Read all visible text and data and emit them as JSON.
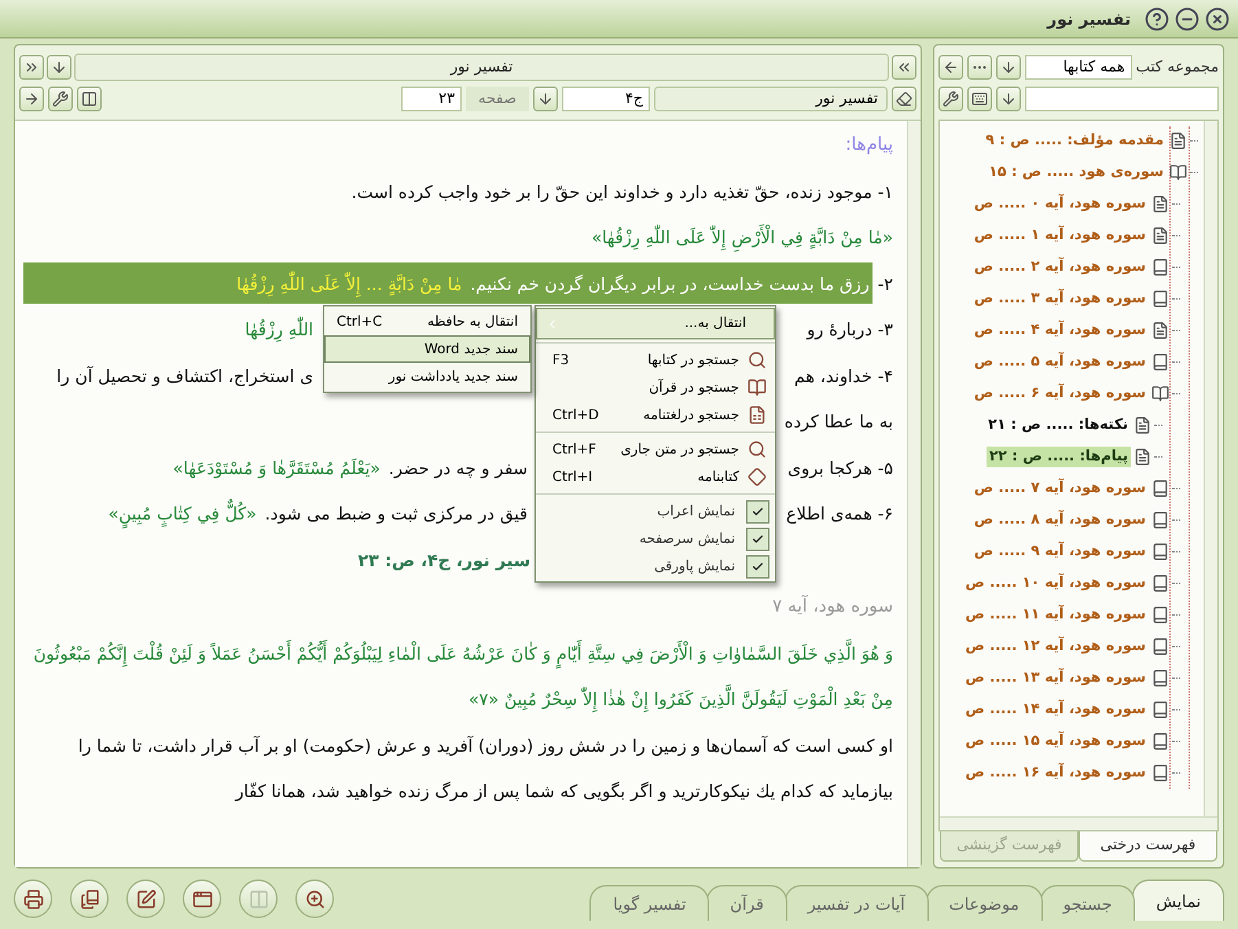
{
  "window": {
    "title": "تفسیر نور"
  },
  "reader": {
    "title": "تفسیر نور",
    "book": "تفسیر نور",
    "volume": "ج۴",
    "page_label": "صفحه",
    "page": "۲۳",
    "lines": [
      {
        "kind": "heading",
        "text": "پیام‌ها:"
      },
      {
        "kind": "text",
        "text": "۱- موجود زنده، حقّ تغذیه دارد و خداوند این حقّ را بر خود واجب کرده است."
      },
      {
        "kind": "verse",
        "text": "«مٰا مِنْ دَابَّةٍ فِي الْأَرْضِ إِلاّٰ عَلَى اللّٰهِ رِزْقُهٰا»"
      },
      {
        "kind": "highlight",
        "number": "۲-",
        "text": "رزق ما بدست خداست، در برابر دیگران گردن خم نکنیم.",
        "verse": "مٰا مِنْ دَابَّةٍ ... إِلاّٰ عَلَى اللّٰهِ رِزْقُهٰا"
      },
      {
        "kind": "split",
        "right": "۳- دربارهٔ رو",
        "verse": "اللّٰهِ رِزْقُهٰا"
      },
      {
        "kind": "split",
        "right": "۴- خداوند، هم",
        "left": "ی استخراج، اکتشاف و تحصیل آن را"
      },
      {
        "kind": "text",
        "text": "به ما عطا کرده"
      },
      {
        "kind": "split",
        "right": "۵- هرکجا بروی",
        "left": "سفر و چه در حضر.",
        "verse": "«يَعْلَمُ مُسْتَقَرَّهٰا وَ مُسْتَوْدَعَهٰا»"
      },
      {
        "kind": "split",
        "right": "۶- همه‌ی اطلاع",
        "left": "قیق در مرکزی ثبت و ضبط می شود.",
        "verse": "«كُلٌّ فِي كِتٰابٍ مُبِينٍ»"
      },
      {
        "kind": "source",
        "text": "سیر نور، ج۴، ص: ۲۳"
      },
      {
        "kind": "subheading",
        "text": "سوره هود، آیه ۷"
      },
      {
        "kind": "verse_block",
        "text": "وَ هُوَ الَّذِي خَلَقَ السَّمٰاوٰاتِ وَ الْأَرْضَ فِي سِتَّةِ أَيّٰامٍ وَ كٰانَ عَرْشُهُ عَلَى الْمٰاءِ لِيَبْلُوَكُمْ أَيُّكُمْ أَحْسَنُ عَمَلاً وَ لَئِنْ قُلْتَ إِنَّكُمْ مَبْعُوثُونَ مِنْ بَعْدِ الْمَوْتِ لَيَقُولَنَّ الَّذِينَ كَفَرُوا إِنْ هٰذٰا إِلاّٰ سِحْرٌ مُبِينٌ «۷»"
      },
      {
        "kind": "text",
        "text": "او كسى است كه آسمان‌ها و زمين را در شش روز (دوران) آفريد و عرش (حكومت) او بر آب قرار داشت، تا شما را بيازمايد كه كدام يك نيكوكارتريد و اگر بگويى كه شما پس از مرگ زنده خواهيد شد، همانا كفّار"
      }
    ],
    "context_menu": {
      "items": [
        {
          "kind": "submenu",
          "label": "انتقال به...",
          "selected": true
        },
        {
          "kind": "separator"
        },
        {
          "kind": "command",
          "label": "جستجو در کتابها",
          "shortcut": "F3",
          "selected": false
        },
        {
          "kind": "command",
          "label": "جستجو در قرآن",
          "selected": false
        },
        {
          "kind": "command",
          "label": "جستجو درلغتنامه",
          "shortcut": "Ctrl+D",
          "selected": false
        },
        {
          "kind": "separator"
        },
        {
          "kind": "command",
          "label": "جستجو در متن جاری",
          "shortcut": "Ctrl+F",
          "selected": false
        },
        {
          "kind": "command",
          "label": "کتابنامه",
          "shortcut": "Ctrl+I",
          "selected": false
        },
        {
          "kind": "separator"
        },
        {
          "kind": "check",
          "label": "نمایش اعراب",
          "checked": true,
          "selected": false
        },
        {
          "kind": "check",
          "label": "نمایش سرصفحه",
          "checked": true,
          "selected": false
        },
        {
          "kind": "check",
          "label": "نمایش پاورقی",
          "checked": true,
          "selected": false
        }
      ],
      "submenu": [
        {
          "label": "انتقال به حافظه",
          "shortcut": "Ctrl+C",
          "selected": false
        },
        {
          "label": "سند جدید Word",
          "selected": true
        },
        {
          "label": "سند جدید یادداشت نور",
          "selected": false
        }
      ]
    }
  },
  "sidebar": {
    "label": "مجموعه کتب",
    "collection": "همه کتابها",
    "tree": [
      {
        "label": "مقدمه مؤلف: ..... ص : ۹",
        "kind": "doc",
        "selected": false
      },
      {
        "label": "سوره‌ی هود ..... ص : ۱۵",
        "kind": "book-open",
        "selected": false,
        "children": [
          {
            "label": "سوره هود، آیه ۰ ..... ص",
            "kind": "doc",
            "selected": false
          },
          {
            "label": "سوره هود، آیه ۱ ..... ص",
            "kind": "doc",
            "selected": false
          },
          {
            "label": "سوره هود، آیه ۲ ..... ص",
            "kind": "book",
            "selected": false
          },
          {
            "label": "سوره هود، آیه ۳ ..... ص",
            "kind": "book",
            "selected": false
          },
          {
            "label": "سوره هود، آیه ۴ ..... ص",
            "kind": "doc",
            "selected": false
          },
          {
            "label": "سوره هود، آیه ۵ ..... ص",
            "kind": "book",
            "selected": false
          },
          {
            "label": "سوره هود، آیه ۶ ..... ص",
            "kind": "book-open",
            "selected": false,
            "children": [
              {
                "label": "نکته‌ها: ..... ص : ۲۱",
                "kind": "doc",
                "selected": false
              },
              {
                "label": "پیام‌ها: ..... ص : ۲۲",
                "kind": "doc",
                "selected": true
              }
            ]
          },
          {
            "label": "سوره هود، آیه ۷ ..... ص",
            "kind": "book",
            "selected": false
          },
          {
            "label": "سوره هود، آیه ۸ ..... ص",
            "kind": "book",
            "selected": false
          },
          {
            "label": "سوره هود، آیه ۹ ..... ص",
            "kind": "book",
            "selected": false
          },
          {
            "label": "سوره هود، آیه ۱۰ ..... ص",
            "kind": "book",
            "selected": false
          },
          {
            "label": "سوره هود، آیه ۱۱ ..... ص",
            "kind": "book",
            "selected": false
          },
          {
            "label": "سوره هود، آیه ۱۲ ..... ص",
            "kind": "book",
            "selected": false
          },
          {
            "label": "سوره هود، آیه ۱۳ ..... ص",
            "kind": "book",
            "selected": false
          },
          {
            "label": "سوره هود، آیه ۱۴ ..... ص",
            "kind": "book",
            "selected": false
          },
          {
            "label": "سوره هود، آیه ۱۵ ..... ص",
            "kind": "book",
            "selected": false
          },
          {
            "label": "سوره هود، آیه ۱۶ ..... ص",
            "kind": "book",
            "selected": false
          }
        ]
      }
    ],
    "tabs": [
      {
        "label": "فهرست درختی",
        "selected": true
      },
      {
        "label": "فهرست گزینشی",
        "selected": false
      }
    ]
  },
  "toolbar": [
    {
      "kind": "print",
      "disabled": false
    },
    {
      "kind": "book",
      "disabled": false
    },
    {
      "kind": "edit",
      "disabled": false
    },
    {
      "kind": "window",
      "disabled": false
    },
    {
      "kind": "columns",
      "disabled": true
    },
    {
      "kind": "zoom",
      "disabled": false
    }
  ],
  "bottom_tabs": [
    {
      "label": "نمایش",
      "selected": true
    },
    {
      "label": "جستجو",
      "selected": false
    },
    {
      "label": "موضوعات",
      "selected": false
    },
    {
      "label": "آیات در تفسیر",
      "selected": false
    },
    {
      "label": "قرآن",
      "selected": false
    },
    {
      "label": "تفسیر گویا",
      "selected": false
    }
  ]
}
